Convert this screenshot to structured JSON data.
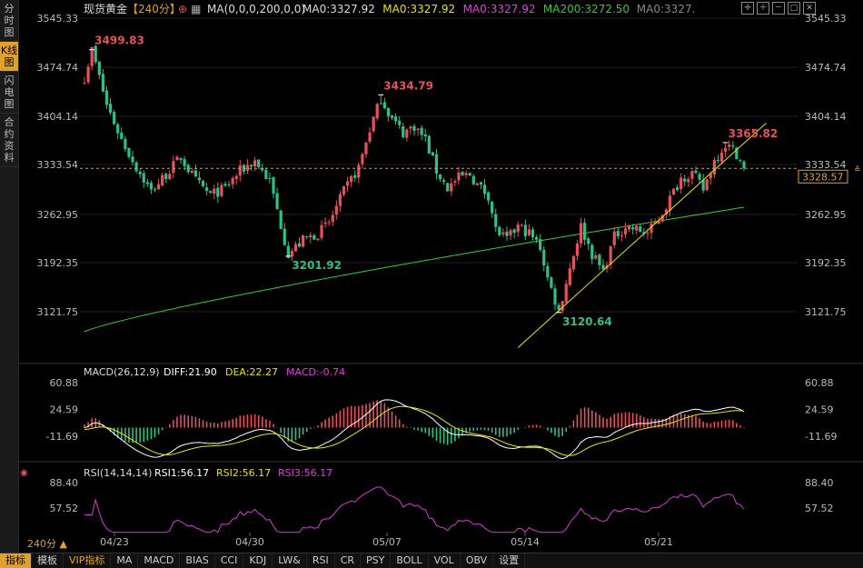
{
  "left_tabs": [
    {
      "label": "分时图",
      "active": false
    },
    {
      "label": "K线图",
      "active": true
    },
    {
      "label": "闪电图",
      "active": false
    },
    {
      "label": "合约资料",
      "active": false
    }
  ],
  "header": {
    "symbol": "现货黄金",
    "period": "【240分】",
    "ma_params": "MA(0,0,0,200,0,0)",
    "ma_values": [
      {
        "text": "MA0:3327.92",
        "color": "#dddddd"
      },
      {
        "text": "MA0:3327.92",
        "color": "#e6e600"
      },
      {
        "text": "MA0:3327.92",
        "color": "#e040e0"
      },
      {
        "text": "MA200:3272.50",
        "color": "#33cc33"
      },
      {
        "text": "MA0:3327.",
        "color": "#888888"
      }
    ]
  },
  "period_label": "240分",
  "macd_header": {
    "params": "MACD(26,12,9)",
    "diff": "DIFF:21.90",
    "dea": "DEA:22.27",
    "macd": "MACD:-0.74"
  },
  "rsi_header": {
    "params": "RSI(14,14,14)",
    "rsi1": "RSI1:56.17",
    "rsi2": "RSI2:56.17",
    "rsi3": "RSI3:56.17"
  },
  "bottom_tabs": [
    {
      "label": "指标",
      "active": true
    },
    {
      "label": "模板",
      "active": false
    },
    {
      "label": "VIP指标",
      "vip": true
    },
    {
      "label": "MA"
    },
    {
      "label": "MACD"
    },
    {
      "label": "BIAS"
    },
    {
      "label": "CCI"
    },
    {
      "label": "KDJ"
    },
    {
      "label": "LW&"
    },
    {
      "label": "RSI"
    },
    {
      "label": "CR"
    },
    {
      "label": "PSY"
    },
    {
      "label": "BOLL"
    },
    {
      "label": "VOL"
    },
    {
      "label": "OBV"
    },
    {
      "label": "设置"
    }
  ],
  "colors": {
    "up": "#e8505b",
    "down": "#2fbf88",
    "ma200": "#33cc33",
    "trendline": "#e6e600",
    "diff": "#ffffff",
    "dea": "#e6e600",
    "rsi": "#d040d0",
    "current_price": "#e0a02a"
  },
  "chart_data": {
    "type": "candlestick",
    "title": "现货黄金 240分",
    "price_axis": {
      "ticks": [
        "3545.33",
        "3474.74",
        "3404.14",
        "3333.54",
        "3262.95",
        "3192.35",
        "3121.75"
      ],
      "ylim": [
        3050,
        3560
      ]
    },
    "current_price": "3328.57",
    "current_price_tick": "3333.54",
    "x_date_labels": [
      "04/23",
      "04/30",
      "05/07",
      "05/14",
      "05/21"
    ],
    "annotations": [
      {
        "text": "3499.83",
        "kind": "high",
        "candle": 2,
        "value": 3499.83
      },
      {
        "text": "3434.79",
        "kind": "high",
        "candle": 80,
        "value": 3434.79
      },
      {
        "text": "3201.92",
        "kind": "low",
        "candle": 55,
        "value": 3201.92
      },
      {
        "text": "3120.64",
        "kind": "low",
        "candle": 128,
        "value": 3120.64
      },
      {
        "text": "3365.82",
        "kind": "high",
        "candle": 173,
        "value": 3365.82
      }
    ],
    "keypoints": [
      [
        0,
        3460
      ],
      [
        2,
        3499.83
      ],
      [
        6,
        3420
      ],
      [
        10,
        3370
      ],
      [
        14,
        3330
      ],
      [
        18,
        3295
      ],
      [
        22,
        3320
      ],
      [
        26,
        3345
      ],
      [
        30,
        3310
      ],
      [
        34,
        3290
      ],
      [
        38,
        3300
      ],
      [
        42,
        3325
      ],
      [
        46,
        3340
      ],
      [
        50,
        3310
      ],
      [
        55,
        3205
      ],
      [
        59,
        3225
      ],
      [
        63,
        3235
      ],
      [
        66,
        3250
      ],
      [
        70,
        3295
      ],
      [
        74,
        3330
      ],
      [
        77,
        3385
      ],
      [
        80,
        3430
      ],
      [
        83,
        3400
      ],
      [
        86,
        3380
      ],
      [
        89,
        3390
      ],
      [
        92,
        3370
      ],
      [
        95,
        3325
      ],
      [
        98,
        3300
      ],
      [
        101,
        3315
      ],
      [
        104,
        3320
      ],
      [
        106,
        3305
      ],
      [
        109,
        3290
      ],
      [
        111,
        3240
      ],
      [
        114,
        3225
      ],
      [
        117,
        3245
      ],
      [
        120,
        3235
      ],
      [
        123,
        3215
      ],
      [
        125,
        3170
      ],
      [
        128,
        3122
      ],
      [
        131,
        3185
      ],
      [
        134,
        3245
      ],
      [
        137,
        3205
      ],
      [
        140,
        3180
      ],
      [
        143,
        3230
      ],
      [
        146,
        3245
      ],
      [
        149,
        3240
      ],
      [
        152,
        3235
      ],
      [
        155,
        3255
      ],
      [
        158,
        3285
      ],
      [
        161,
        3315
      ],
      [
        164,
        3322
      ],
      [
        167,
        3298
      ],
      [
        170,
        3340
      ],
      [
        173,
        3364
      ],
      [
        176,
        3350
      ],
      [
        178,
        3328.57
      ]
    ],
    "candle_count": 179,
    "ma200": {
      "name": "MA200",
      "start": 3093,
      "end": 3272.5
    },
    "trendline": {
      "from": [
        117,
        3070
      ],
      "to": [
        184,
        3394
      ]
    },
    "macd": {
      "ticks": [
        "60.88",
        "24.59",
        "-11.69"
      ],
      "ylim": [
        -45,
        75
      ],
      "diff": 21.9,
      "dea": 22.27,
      "macd": -0.74
    },
    "rsi": {
      "ticks": [
        "88.40",
        "57.52"
      ],
      "ylim": [
        25,
        100
      ],
      "value": 56.17
    }
  }
}
